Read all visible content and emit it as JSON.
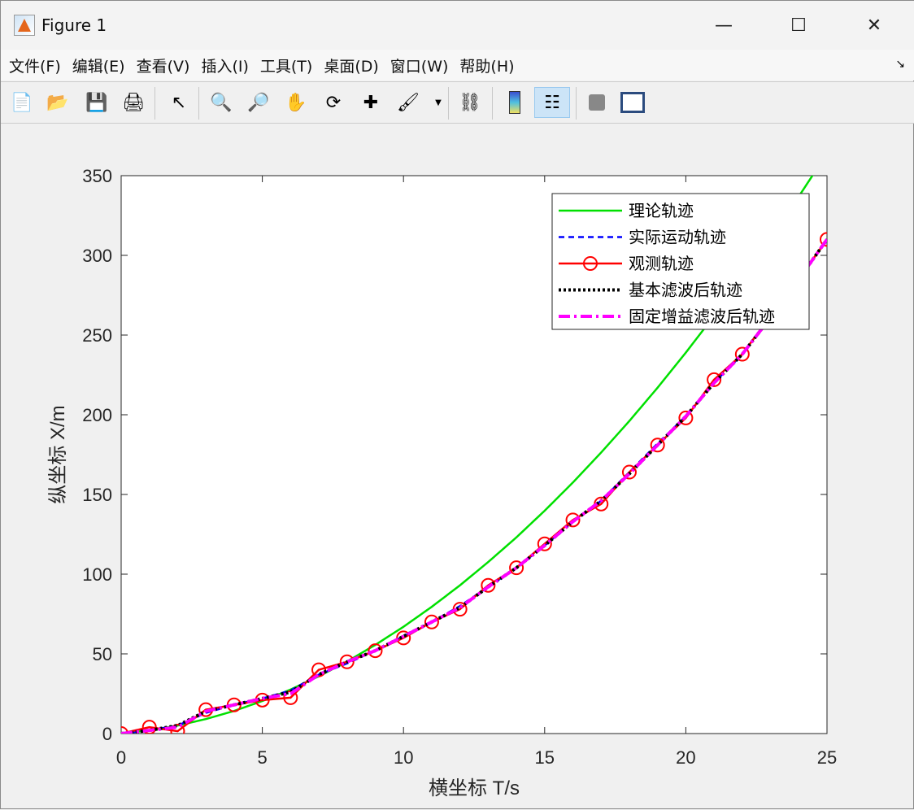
{
  "window": {
    "title": "Figure 1",
    "minimize": "—",
    "maximize": "☐",
    "close": "✕"
  },
  "menu": [
    "文件(F)",
    "编辑(E)",
    "查看(V)",
    "插入(I)",
    "工具(T)",
    "桌面(D)",
    "窗口(W)",
    "帮助(H)"
  ],
  "menu_more": "↘",
  "toolbar": [
    "new-file",
    "open-folder",
    "save",
    "print",
    "pointer",
    "zoom-in",
    "zoom-out",
    "pan",
    "rotate-3d",
    "data-cursor",
    "brush",
    "link",
    "colorbar",
    "legend",
    "hide-tools",
    "dock"
  ],
  "chart_data": {
    "type": "line",
    "xlabel": "横坐标 T/s",
    "ylabel": "纵坐标 X/m",
    "xlim": [
      0,
      25
    ],
    "ylim": [
      0,
      350
    ],
    "xticks": [
      0,
      5,
      10,
      15,
      20,
      25
    ],
    "yticks": [
      0,
      50,
      100,
      150,
      200,
      250,
      300,
      350
    ],
    "legend_position": "top-right",
    "x": [
      0,
      1,
      2,
      3,
      4,
      5,
      6,
      7,
      8,
      9,
      10,
      11,
      12,
      13,
      14,
      15,
      16,
      17,
      18,
      19,
      20,
      21,
      22,
      23,
      24,
      25
    ],
    "series": [
      {
        "name": "理论轨迹",
        "color": "#00e000",
        "style": "solid",
        "theory": true,
        "values": [
          0,
          2,
          5,
          9.1,
          14.2,
          20.4,
          27.6,
          35.9,
          45.2,
          55.6,
          67,
          79.5,
          93,
          107.6,
          123.1,
          139.8,
          157.5,
          176.3,
          196.1,
          217,
          239,
          262,
          285.7,
          310.8,
          336.9,
          364
        ]
      },
      {
        "name": "实际运动轨迹",
        "color": "#0000ff",
        "style": "dashed",
        "values": [
          0,
          2,
          5,
          13,
          18,
          22,
          27,
          37,
          44,
          52,
          61,
          70,
          80,
          92,
          104,
          118,
          133,
          146,
          164,
          182,
          199,
          220,
          238,
          262,
          285,
          310
        ]
      },
      {
        "name": "观测轨迹",
        "color": "#ff0000",
        "style": "circle",
        "values": [
          0,
          4,
          1.5,
          15,
          18,
          21,
          22.5,
          40,
          45,
          52,
          60,
          70,
          78,
          93,
          104,
          119,
          134,
          144,
          164,
          181,
          198,
          222,
          238,
          262,
          285,
          310
        ]
      },
      {
        "name": "基本滤波后轨迹",
        "color": "#000000",
        "style": "dotted",
        "values": [
          0,
          2,
          5,
          14,
          18,
          22,
          26,
          37,
          45,
          52,
          61,
          70,
          79,
          92,
          104,
          118,
          133,
          146,
          163,
          181,
          199,
          220,
          238,
          261,
          285,
          310
        ]
      },
      {
        "name": "固定增益滤波后轨迹",
        "color": "#ff00ff",
        "style": "dashdot",
        "values": [
          0,
          2,
          4,
          14,
          18,
          22,
          25,
          37,
          45,
          52,
          61,
          70,
          79,
          92,
          104,
          118,
          133,
          146,
          163,
          181,
          199,
          220,
          238,
          261,
          285,
          310
        ]
      }
    ]
  }
}
